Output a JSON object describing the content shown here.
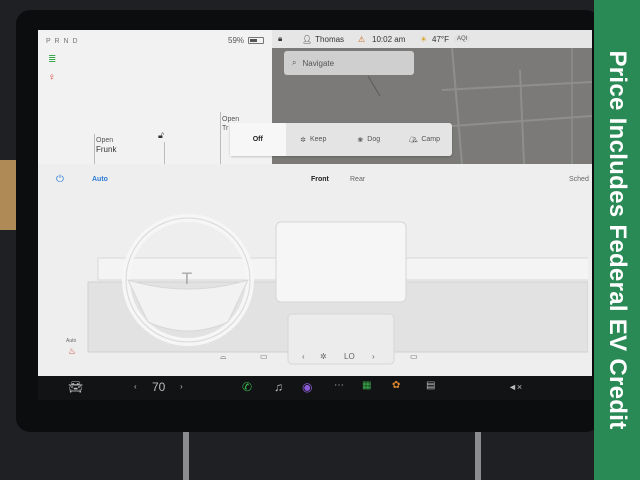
{
  "banner": {
    "text": "Price Includes Federal EV Credit"
  },
  "status": {
    "gear": "P R N D",
    "battery_percent": "59%",
    "battery_level": 0.59,
    "driver": "Thomas",
    "time": "10:02 am",
    "temperature": "47°F",
    "aqi": "AQI"
  },
  "car": {
    "frunk": {
      "line1": "Open",
      "line2": "Frunk"
    },
    "trunk": {
      "line1": "Open",
      "line2": "Tr"
    }
  },
  "map": {
    "search_placeholder": "Navigate",
    "modes": [
      {
        "label": "Off",
        "icon": "off",
        "selected": true
      },
      {
        "label": "Keep",
        "icon": "fan-icon",
        "selected": false
      },
      {
        "label": "Dog",
        "icon": "paw-icon",
        "selected": false
      },
      {
        "label": "Camp",
        "icon": "tent-icon",
        "selected": false
      }
    ]
  },
  "climate": {
    "auto": "Auto",
    "tab_front": "Front",
    "tab_rear": "Rear",
    "schedule": "Sched",
    "fan_speed": "LO",
    "seat_heater_label": "Auto"
  },
  "taskbar": {
    "temperature": "70",
    "volume": "◄×"
  }
}
